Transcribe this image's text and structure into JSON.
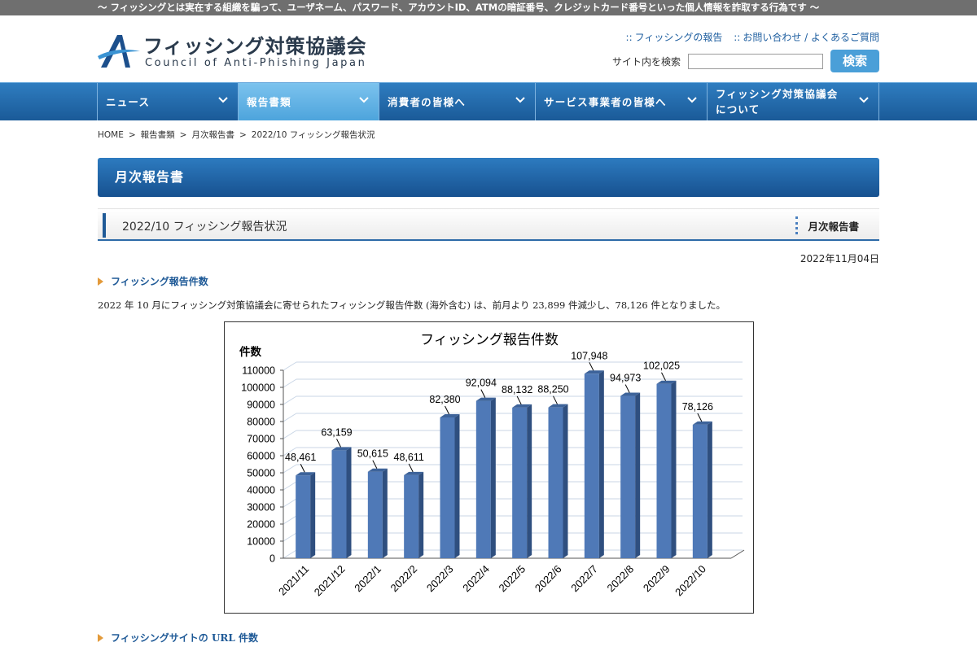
{
  "top_strip": {
    "text": "〜 フィッシングとは実在する組織を騙って、ユーザネーム、パスワード、アカウントID、ATMの暗証番号、クレジットカード番号といった個人情報を詐取する行為です 〜"
  },
  "header": {
    "logo_jp": "フィッシング対策協議会",
    "logo_en": "Council of Anti-Phishing Japan",
    "links": [
      {
        "label": "フィッシングの報告"
      },
      {
        "label": "お問い合わせ / よくあるご質問"
      }
    ],
    "link_prefix": "::",
    "search_label": "サイト内を検索",
    "search_button": "検索"
  },
  "nav": {
    "items": [
      {
        "label": "ニュース",
        "active": false
      },
      {
        "label": "報告書類",
        "active": true
      },
      {
        "label": "消費者の皆様へ",
        "active": false
      },
      {
        "label": "サービス事業者の皆様へ",
        "active": false
      },
      {
        "label": "フィッシング対策協議会\nについて",
        "active": false
      }
    ]
  },
  "breadcrumb": [
    "HOME",
    "報告書類",
    "月次報告書",
    "2022/10 フィッシング報告状況"
  ],
  "breadcrumb_sep": ">",
  "page_banner": "月次報告書",
  "article": {
    "title": "2022/10 フィッシング報告状況",
    "category": "月次報告書",
    "date": "2022年11月04日"
  },
  "section1": {
    "heading": "フィッシング報告件数",
    "text": "2022 年 10 月にフィッシング対策協議会に寄せられたフィッシング報告件数 (海外含む) は、前月より 23,899 件減少し、78,126 件となりました。"
  },
  "section2": {
    "heading": "フィッシングサイトの URL 件数"
  },
  "chart_data": {
    "type": "bar",
    "title": "フィッシング報告件数",
    "ylabel": "件数",
    "xlabel": "",
    "categories": [
      "2021/11",
      "2021/12",
      "2022/1",
      "2022/2",
      "2022/3",
      "2022/4",
      "2022/5",
      "2022/6",
      "2022/7",
      "2022/8",
      "2022/9",
      "2022/10"
    ],
    "values": [
      48461,
      63159,
      50615,
      48611,
      82380,
      92094,
      88132,
      88250,
      107948,
      94973,
      102025,
      78126
    ],
    "data_labels": [
      "48,461",
      "63,159",
      "50,615",
      "48,611",
      "82,380",
      "92,094",
      "88,132",
      "88,250",
      "107,948",
      "94,973",
      "102,025",
      "78,126"
    ],
    "yticks": [
      0,
      10000,
      20000,
      30000,
      40000,
      50000,
      60000,
      70000,
      80000,
      90000,
      100000,
      110000
    ],
    "ylim": [
      0,
      110000
    ],
    "grid": true,
    "bar_color": "#4f79b7"
  }
}
